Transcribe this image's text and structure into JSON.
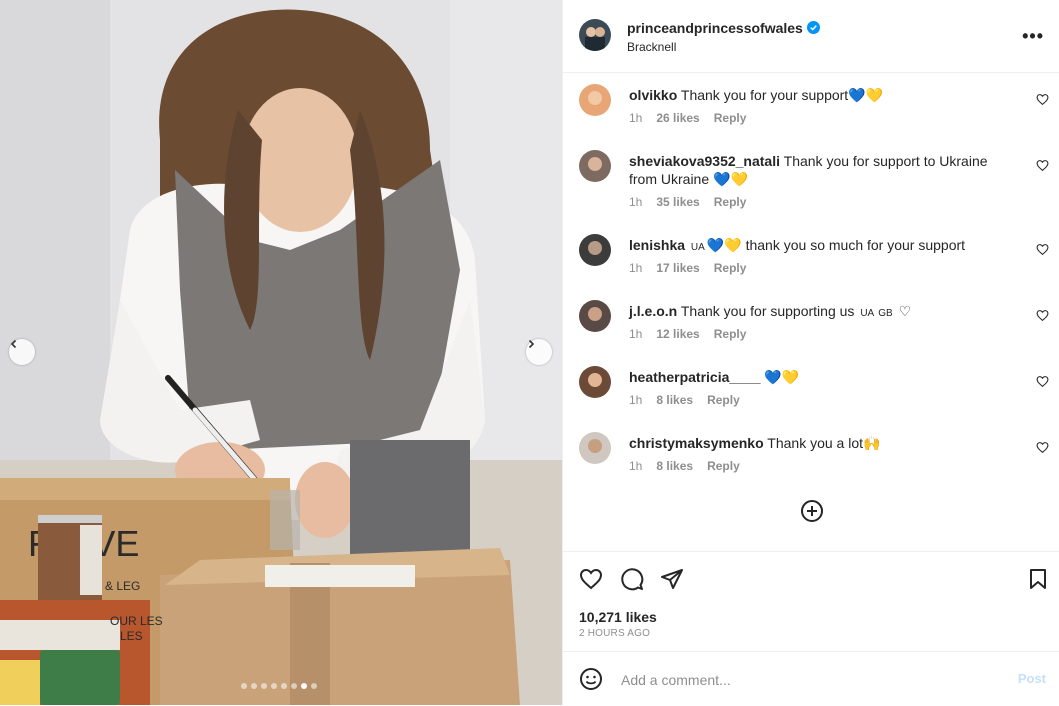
{
  "post": {
    "username": "princeandprincessofwales",
    "location": "Bracknell",
    "likes": "10,271 likes",
    "time": "2 HOURS AGO",
    "carousel": {
      "total": 8,
      "active_index": 6
    },
    "box_text": "F    TIVE",
    "can_label": "& LEG",
    "can_label2": "OUR LES",
    "can_label3": "LES"
  },
  "comments": [
    {
      "user": "olvikko",
      "text": "Thank you for your support",
      "emoji": "💙💛",
      "time": "1h",
      "likes": "26 likes",
      "reply": "Reply"
    },
    {
      "user": "sheviakova9352_natali",
      "text": "Thank you for support to Ukraine from Ukraine",
      "emoji": "💙💛",
      "time": "1h",
      "likes": "35 likes",
      "reply": "Reply"
    },
    {
      "user": "lenishka",
      "flag": "UA",
      "emoji_pre": "💙💛",
      "text": "thank you so much for your support",
      "time": "1h",
      "likes": "17 likes",
      "reply": "Reply"
    },
    {
      "user": "j.l.e.o.n",
      "text": "Thank you for supporting us",
      "flag1": "UA",
      "flag2": "GB",
      "emoji": "♡",
      "time": "1h",
      "likes": "12 likes",
      "reply": "Reply"
    },
    {
      "user": "heatherpatricia____",
      "text": "",
      "emoji": "💙💛",
      "time": "1h",
      "likes": "8 likes",
      "reply": "Reply"
    },
    {
      "user": "christymaksymenko",
      "text": "Thank you a lot",
      "emoji": "🙌",
      "time": "1h",
      "likes": "8 likes",
      "reply": "Reply"
    }
  ],
  "composer": {
    "placeholder": "Add a comment...",
    "post_label": "Post"
  },
  "icons": {
    "more": "more-options-icon",
    "verified": "verified-badge-icon",
    "like": "heart-icon",
    "comment": "comment-icon",
    "share": "share-icon",
    "save": "bookmark-icon",
    "emoji": "emoji-icon",
    "load_more": "plus-circle-icon"
  },
  "colors": {
    "verified": "#0095f6",
    "post_disabled": "#c7dffa",
    "muted": "#8e8e8e"
  }
}
